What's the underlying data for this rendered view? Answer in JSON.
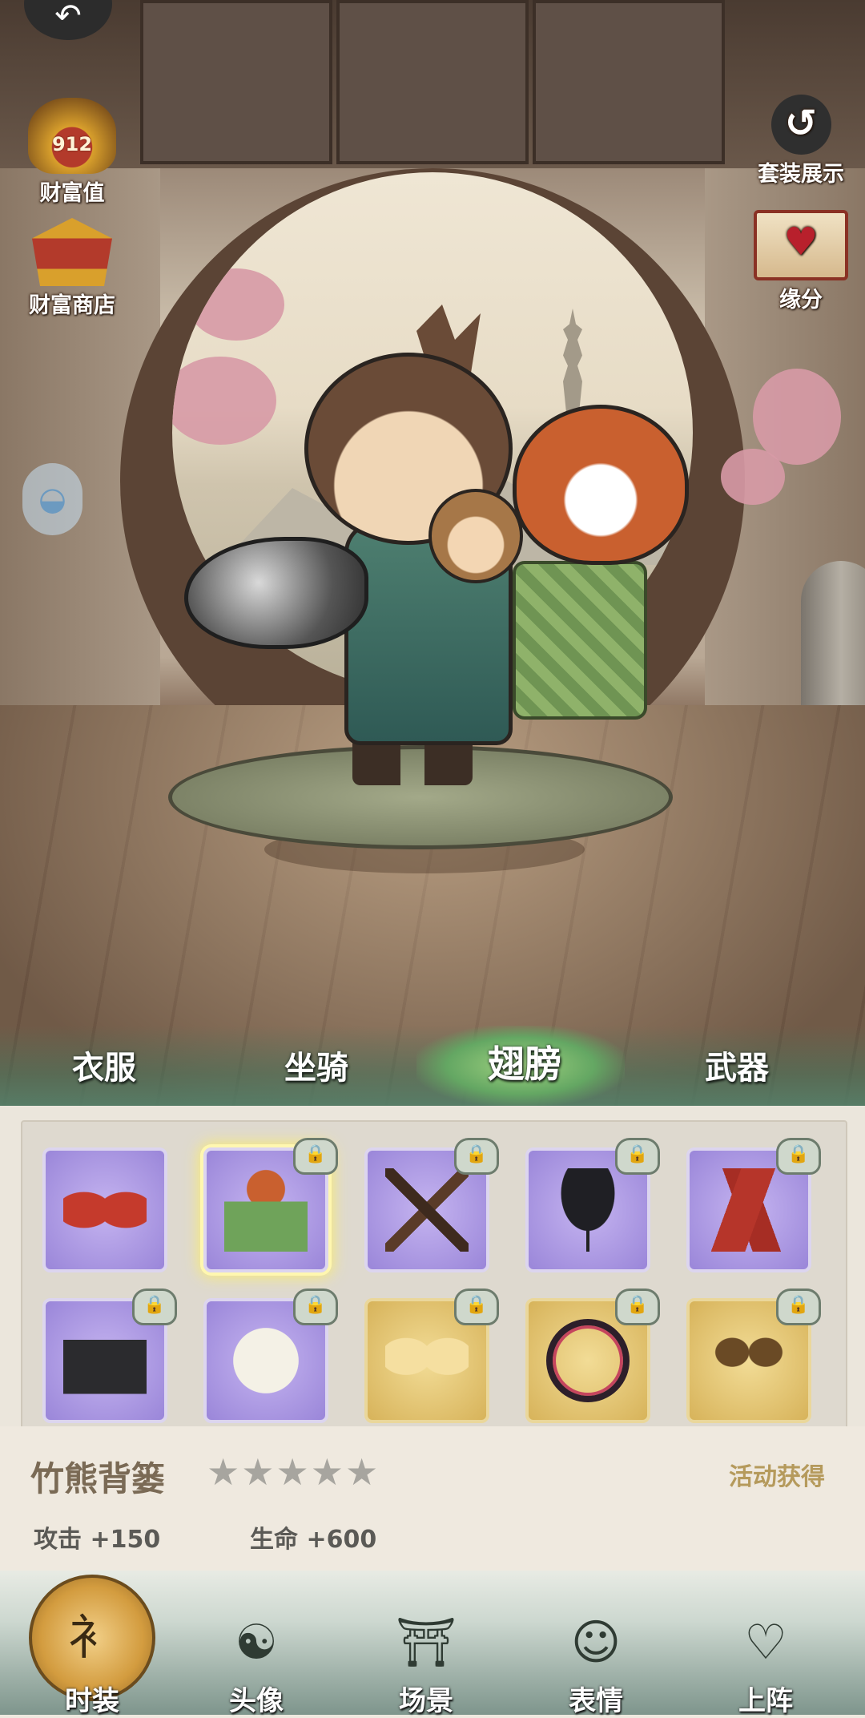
{
  "side_buttons": {
    "wealth": {
      "label": "财富值",
      "value": "912",
      "icon": "gold-pot-icon"
    },
    "shop": {
      "label": "财富商店",
      "icon": "shop-pavilion-icon"
    },
    "suit": {
      "label": "套装展示",
      "icon": "swirl-icon"
    },
    "fate": {
      "label": "缘分",
      "icon": "heart-scroll-icon"
    }
  },
  "tabs": [
    {
      "label": "衣服"
    },
    {
      "label": "坐骑"
    },
    {
      "label": "翅膀",
      "active": true
    },
    {
      "label": "武器"
    }
  ],
  "items": [
    {
      "art": "red-wings",
      "rarity": "purple",
      "locked": false
    },
    {
      "art": "red-panda-basket",
      "rarity": "purple",
      "locked": true,
      "selected": true
    },
    {
      "art": "crossbow",
      "rarity": "purple",
      "locked": true
    },
    {
      "art": "black-umbrella",
      "rarity": "purple",
      "locked": true
    },
    {
      "art": "red-banners",
      "rarity": "purple",
      "locked": true
    },
    {
      "art": "golf-bag",
      "rarity": "purple",
      "locked": true
    },
    {
      "art": "pillow",
      "rarity": "purple",
      "locked": true
    },
    {
      "art": "golden-feather-wings",
      "rarity": "gold",
      "locked": true
    },
    {
      "art": "flower-ring",
      "rarity": "gold",
      "locked": true
    },
    {
      "art": "dragon-horns",
      "rarity": "gold",
      "locked": true
    }
  ],
  "selected_item": {
    "name": "竹熊背篓",
    "stars_filled": 0,
    "stars_total": 5,
    "source": "活动获得",
    "stats": [
      {
        "label": "攻击 +150"
      },
      {
        "label": "生命 +600"
      }
    ]
  },
  "nav": [
    {
      "label": "时装",
      "icon": "fashion-emblem-icon",
      "active": true
    },
    {
      "label": "头像",
      "icon": "avatar-emblem-icon"
    },
    {
      "label": "场景",
      "icon": "scene-pavilion-icon"
    },
    {
      "label": "表情",
      "icon": "emote-face-icon"
    },
    {
      "label": "上阵",
      "icon": "deploy-heart-icon"
    }
  ],
  "colors": {
    "accent_gold": "#d39c3f",
    "tab_green": "#56806a",
    "purple_slot": "#9a86d9",
    "gold_slot": "#d7b35a"
  }
}
